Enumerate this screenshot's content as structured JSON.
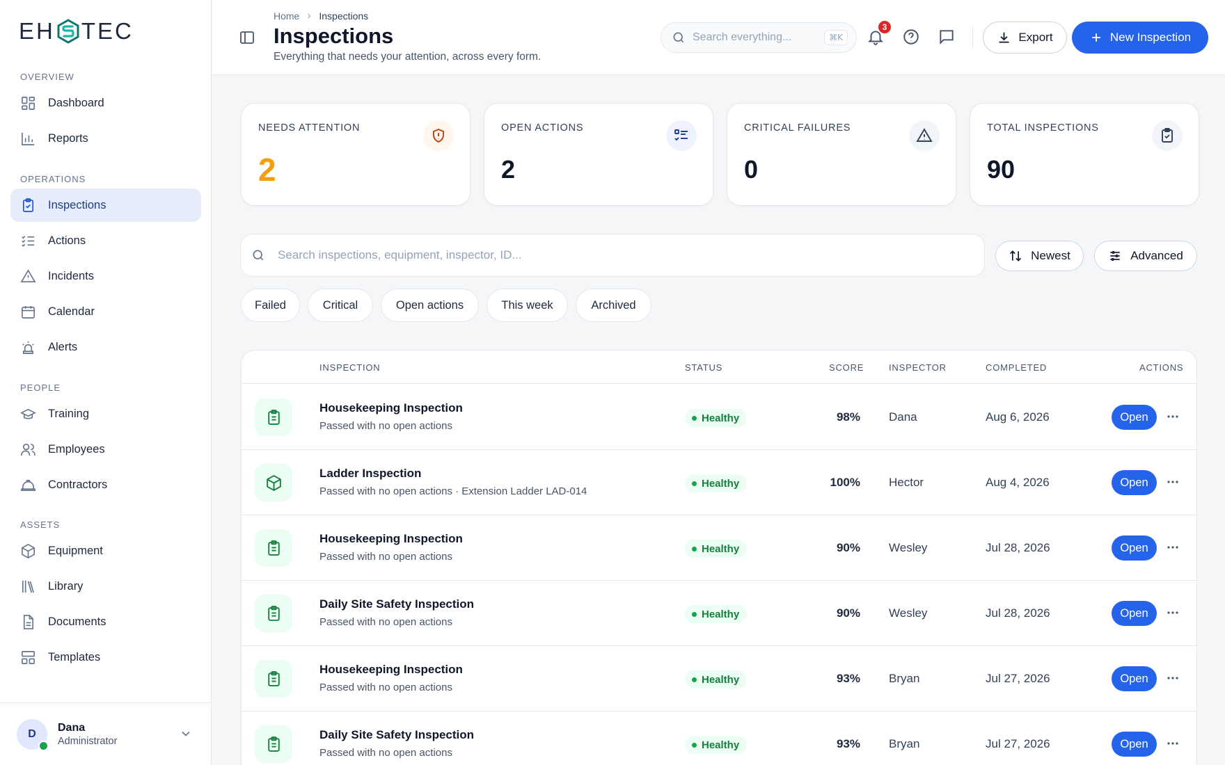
{
  "brand": {
    "logo_left": "EH",
    "logo_right": "TEC"
  },
  "sidebar": {
    "sections": [
      {
        "label": "OVERVIEW",
        "items": [
          {
            "label": "Dashboard",
            "icon": "dashboard-icon"
          },
          {
            "label": "Reports",
            "icon": "bar-chart-icon"
          }
        ]
      },
      {
        "label": "OPERATIONS",
        "items": [
          {
            "label": "Inspections",
            "icon": "clipboard-check-icon",
            "active": true
          },
          {
            "label": "Actions",
            "icon": "list-check-icon"
          },
          {
            "label": "Incidents",
            "icon": "warning-icon"
          },
          {
            "label": "Calendar",
            "icon": "calendar-icon"
          },
          {
            "label": "Alerts",
            "icon": "siren-icon"
          }
        ]
      },
      {
        "label": "PEOPLE",
        "items": [
          {
            "label": "Training",
            "icon": "graduation-cap-icon"
          },
          {
            "label": "Employees",
            "icon": "users-icon"
          },
          {
            "label": "Contractors",
            "icon": "hard-hat-icon"
          }
        ]
      },
      {
        "label": "ASSETS",
        "items": [
          {
            "label": "Equipment",
            "icon": "package-icon"
          },
          {
            "label": "Library",
            "icon": "library-icon"
          },
          {
            "label": "Documents",
            "icon": "document-icon"
          },
          {
            "label": "Templates",
            "icon": "template-icon"
          }
        ]
      }
    ],
    "user": {
      "initial": "D",
      "name": "Dana",
      "role": "Administrator"
    }
  },
  "header": {
    "breadcrumb": [
      "Home",
      "Inspections"
    ],
    "title": "Inspections",
    "subtitle": "Everything that needs your attention, across every form.",
    "search_placeholder": "Search everything...",
    "search_shortcut": "⌘K",
    "notification_count": "3",
    "export_label": "Export",
    "new_label": "New Inspection"
  },
  "stats": [
    {
      "label": "NEEDS ATTENTION",
      "value": "2",
      "icon": "shield-alert-icon",
      "accent": "#f59e0b"
    },
    {
      "label": "OPEN ACTIONS",
      "value": "2",
      "icon": "list-check-icon",
      "accent": "#1e3a8a"
    },
    {
      "label": "CRITICAL FAILURES",
      "value": "0",
      "icon": "warning-icon",
      "accent": "#334155"
    },
    {
      "label": "TOTAL INSPECTIONS",
      "value": "90",
      "icon": "clipboard-check-icon",
      "accent": "#334155"
    }
  ],
  "filters": {
    "search_placeholder": "Search inspections, equipment, inspector, ID...",
    "sort_label": "Newest",
    "advanced_label": "Advanced",
    "chips": [
      "Failed",
      "Critical",
      "Open actions",
      "This week",
      "Archived"
    ]
  },
  "table": {
    "columns": [
      "INSPECTION",
      "STATUS",
      "SCORE",
      "INSPECTOR",
      "COMPLETED",
      "ACTIONS"
    ],
    "open_label": "Open",
    "rows": [
      {
        "title": "Housekeeping Inspection",
        "subtitle": "Passed with no open actions",
        "status": "Healthy",
        "score": "98%",
        "inspector": "Dana",
        "completed": "Aug 6, 2026",
        "icon": "clipboard-list-icon"
      },
      {
        "title": "Ladder Inspection",
        "subtitle": "Passed with no open actions · Extension Ladder LAD-014",
        "status": "Healthy",
        "score": "100%",
        "inspector": "Hector",
        "completed": "Aug 4, 2026",
        "icon": "package-icon"
      },
      {
        "title": "Housekeeping Inspection",
        "subtitle": "Passed with no open actions",
        "status": "Healthy",
        "score": "90%",
        "inspector": "Wesley",
        "completed": "Jul 28, 2026",
        "icon": "clipboard-list-icon"
      },
      {
        "title": "Daily Site Safety Inspection",
        "subtitle": "Passed with no open actions",
        "status": "Healthy",
        "score": "90%",
        "inspector": "Wesley",
        "completed": "Jul 28, 2026",
        "icon": "clipboard-list-icon"
      },
      {
        "title": "Housekeeping Inspection",
        "subtitle": "Passed with no open actions",
        "status": "Healthy",
        "score": "93%",
        "inspector": "Bryan",
        "completed": "Jul 27, 2026",
        "icon": "clipboard-list-icon"
      },
      {
        "title": "Daily Site Safety Inspection",
        "subtitle": "Passed with no open actions",
        "status": "Healthy",
        "score": "93%",
        "inspector": "Bryan",
        "completed": "Jul 27, 2026",
        "icon": "clipboard-list-icon"
      }
    ]
  },
  "colors": {
    "primary": "#2563eb",
    "healthy": "#16a34a",
    "warning": "#f59e0b",
    "danger": "#dc2626"
  }
}
